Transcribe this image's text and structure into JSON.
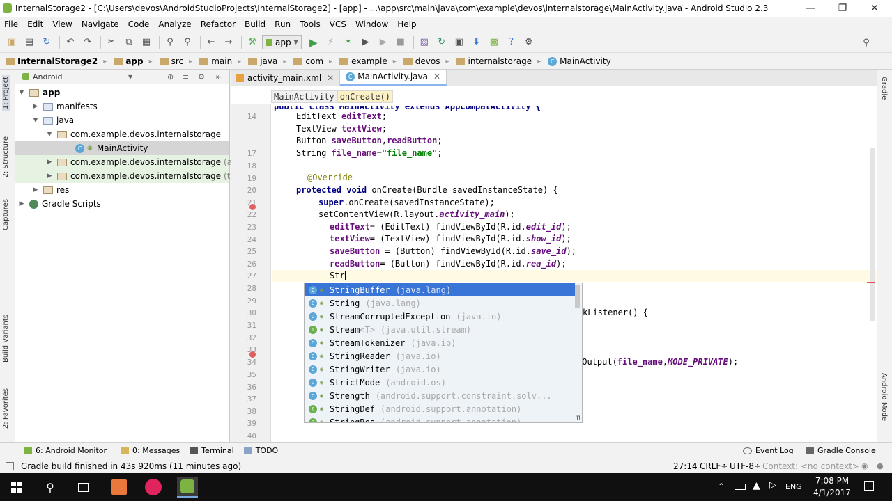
{
  "window": {
    "title": "InternalStorage2 - [C:\\Users\\devos\\AndroidStudioProjects\\InternalStorage2] - [app] - ...\\app\\src\\main\\java\\com\\example\\devos\\internalstorage\\MainActivity.java - Android Studio 2.3"
  },
  "menu": [
    "File",
    "Edit",
    "View",
    "Navigate",
    "Code",
    "Analyze",
    "Refactor",
    "Build",
    "Run",
    "Tools",
    "VCS",
    "Window",
    "Help"
  ],
  "toolbar": {
    "run_config": "app"
  },
  "breadcrumbs": [
    "InternalStorage2",
    "app",
    "src",
    "main",
    "java",
    "com",
    "example",
    "devos",
    "internalstorage",
    "MainActivity"
  ],
  "left_tools": [
    "1: Project",
    "2: Structure",
    "Captures",
    "Build Variants",
    "2: Favorites"
  ],
  "right_tools": [
    "Gradle",
    "Android Model"
  ],
  "project_panel": {
    "view_mode": "Android",
    "tree": [
      {
        "label": "app",
        "depth": 0
      },
      {
        "label": "manifests",
        "depth": 1
      },
      {
        "label": "java",
        "depth": 1
      },
      {
        "label": "com.example.devos.internalstorage",
        "depth": 2
      },
      {
        "label": "MainActivity",
        "depth": 3
      },
      {
        "label": "com.example.devos.internalstorage",
        "suffix": "(andro",
        "depth": 2
      },
      {
        "label": "com.example.devos.internalstorage",
        "suffix": "(test)",
        "depth": 2
      },
      {
        "label": "res",
        "depth": 1
      },
      {
        "label": "Gradle Scripts",
        "depth": 0
      }
    ]
  },
  "editor_tabs": [
    {
      "label": "activity_main.xml"
    },
    {
      "label": "MainActivity.java"
    }
  ],
  "code_breadcrumb": [
    "MainActivity",
    "onCreate()"
  ],
  "line_numbers": [
    "14",
    "17",
    "18",
    "19",
    "20",
    "21",
    "22",
    "23",
    "24",
    "25",
    "26",
    "27",
    "28",
    "29",
    "30",
    "31",
    "32",
    "33",
    "34",
    "35",
    "36",
    "37",
    "38",
    "39",
    "40"
  ],
  "code": {
    "l13": "public class MainActivity extends AppCompatActivity {",
    "l14a": "EditText ",
    "l14b": "editText",
    "l14c": ";",
    "l15a": "TextView ",
    "l15b": "textView",
    "l15c": ";",
    "l16a": "Button ",
    "l16b": "saveButton",
    "l16c": ",",
    "l16d": "readButton",
    "l16e": ";",
    "l17a": "String ",
    "l17b": "file_name",
    "l17c": "=",
    "l17d": "\"file_name\"",
    "l17e": ";",
    "l19": "@Override",
    "l20a": "protected void ",
    "l20b": "onCreate(Bundle savedInstanceState) {",
    "l21a": "super",
    "l21b": ".onCreate(savedInstanceState);",
    "l22a": "setContentView(R.layout.",
    "l22b": "activity_main",
    "l22c": ");",
    "l23a": "editText",
    "l23b": "= (EditText) findViewById(R.id.",
    "l23c": "edit_id",
    "l23d": ");",
    "l24a": "textView",
    "l24b": "= (TextView) findViewById(R.id.",
    "l24c": "show_id",
    "l24d": ");",
    "l25a": "saveButton",
    "l25b": " = (Button) findViewById(R.id.",
    "l25c": "save_id",
    "l25d": ");",
    "l26a": "readButton",
    "l26b": "= (Button) findViewById(R.id.",
    "l26c": "rea_id",
    "l26d": ");",
    "l27": "Str",
    "l30": "kListener() {",
    "l34a": "eOutput(",
    "l34b": "file_name",
    "l34c": ",",
    "l34d": "MODE_PRIVATE",
    "l34e": ");"
  },
  "completion": [
    {
      "name": "StringBuffer",
      "pkg": "(java.lang)",
      "kind": "C"
    },
    {
      "name": "String",
      "pkg": "(java.lang)",
      "kind": "C"
    },
    {
      "name": "StreamCorruptedException",
      "pkg": "(java.io)",
      "kind": "C"
    },
    {
      "name": "Stream",
      "generic": "<T>",
      "pkg": "(java.util.stream)",
      "kind": "I"
    },
    {
      "name": "StreamTokenizer",
      "pkg": "(java.io)",
      "kind": "C"
    },
    {
      "name": "StringReader",
      "pkg": "(java.io)",
      "kind": "C"
    },
    {
      "name": "StringWriter",
      "pkg": "(java.io)",
      "kind": "C"
    },
    {
      "name": "StrictMode",
      "pkg": "(android.os)",
      "kind": "C"
    },
    {
      "name": "Strength",
      "pkg": "(android.support.constraint.solv...",
      "kind": "C"
    },
    {
      "name": "StringDef",
      "pkg": "(android.support.annotation)",
      "kind": "@"
    },
    {
      "name": "StringRes",
      "pkg": "(android.support.annotation)",
      "kind": "@"
    }
  ],
  "bottom_tools_left": [
    "6: Android Monitor",
    "0: Messages",
    "Terminal",
    "TODO"
  ],
  "bottom_tools_right": [
    "Event Log",
    "Gradle Console"
  ],
  "status": {
    "message": "Gradle build finished in 43s 920ms (11 minutes ago)",
    "position": "27:14",
    "line_sep": "CRLF÷",
    "encoding": "UTF-8÷",
    "context": "Context: <no context>"
  },
  "taskbar": {
    "time": "7:08 PM",
    "date": "4/1/2017",
    "lang": "ENG"
  }
}
